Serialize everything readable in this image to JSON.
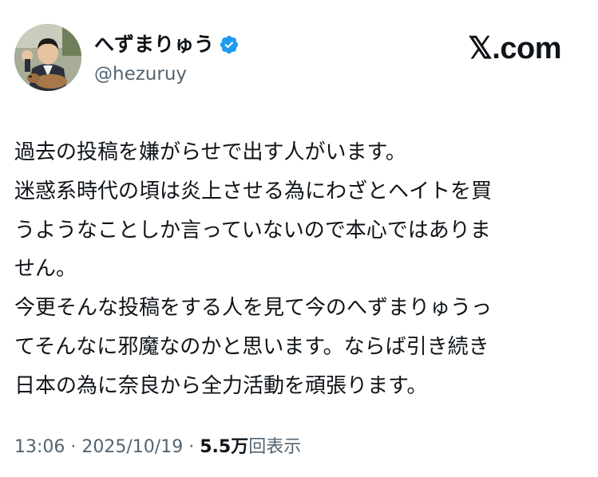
{
  "profile": {
    "display_name": "へずまりゅう",
    "handle": "@hezuruy",
    "verified_icon": "verified-badge-icon",
    "verified_color": "#1d9bf0"
  },
  "brand": {
    "label": "𝕏.com"
  },
  "tweet": {
    "lines": [
      "過去の投稿を嫌がらせで出す人がいます。",
      "迷惑系時代の頃は炎上させる為にわざとヘイトを買",
      "うようなことしか言っていないので本心ではありま",
      "せん。",
      "今更そんな投稿をする人を見て今のへずまりゅうっ",
      "てそんなに邪魔なのかと思います。ならば引き続き",
      "日本の為に奈良から全力活動を頑張ります。"
    ]
  },
  "meta": {
    "time": "13:06",
    "separator": "·",
    "date": "2025/10/19",
    "views_count": "5.5万",
    "views_label": "回表示"
  },
  "colors": {
    "text": "#0f1419",
    "secondary": "#536471",
    "accent": "#1d9bf0"
  }
}
